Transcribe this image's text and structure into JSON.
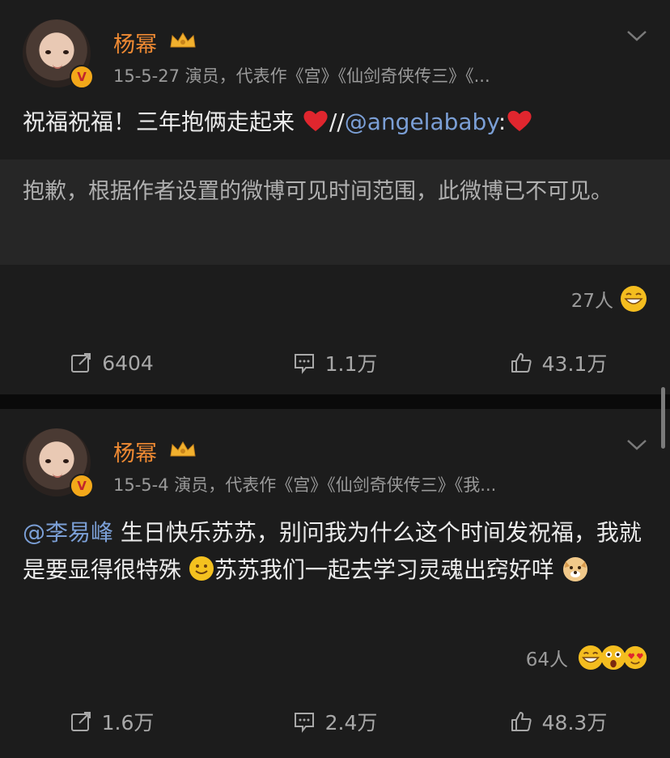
{
  "posts": [
    {
      "username": "杨幂",
      "meta": "15-5-27  演员，代表作《宫》《仙剑奇侠传三》《...",
      "text_before": "祝福祝福！三年抱俩走起来 ",
      "text_slashes": "//",
      "mention": "@angelababy",
      "text_after": ":",
      "quote": "抱歉，根据作者设置的微博可见时间范围，此微博已不可见。",
      "reactions_count": "27人",
      "repost": "6404",
      "comments": "1.1万",
      "likes": "43.1万"
    },
    {
      "username": "杨幂",
      "meta": "15-5-4  演员，代表作《宫》《仙剑奇侠传三》《我...",
      "mention": "@李易峰",
      "text_part1": " 生日快乐苏苏，别问我为什么这个时间发祝福，我就是要显得很特殊 ",
      "text_part2": "苏苏我们一起去学习灵魂出窍好咩 ",
      "reactions_count": "64人",
      "repost": "1.6万",
      "comments": "2.4万",
      "likes": "48.3万"
    }
  ],
  "colors": {
    "username": "#ef8a33",
    "mention": "#7b9fd6",
    "background": "#1c1c1c"
  },
  "icons": [
    "chevron-down-icon",
    "crown-icon",
    "verified-badge-icon",
    "repost-icon",
    "comment-icon",
    "like-icon",
    "heart-emoji",
    "grin-emoji",
    "smile-emoji",
    "doge-emoji"
  ]
}
